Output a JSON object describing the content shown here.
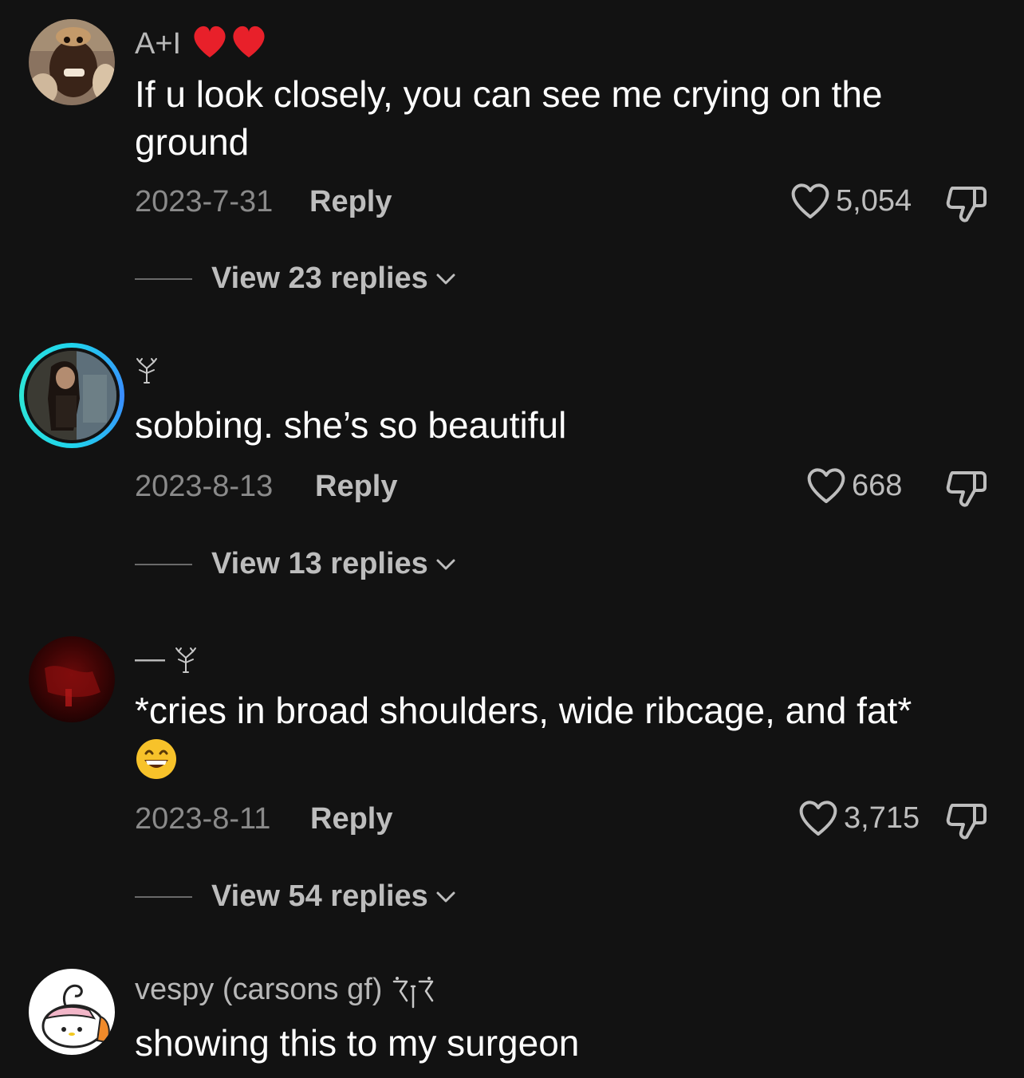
{
  "comments": [
    {
      "username": "A+I",
      "username_emoji": "heart-heart",
      "text": "If u look closely, you can see me crying on the ground",
      "date": "2023-7-31",
      "reply_label": "Reply",
      "likes": "5,054",
      "view_replies": "View 23 replies"
    },
    {
      "username": "",
      "username_glyph": "tree-glyph",
      "text": "sobbing. she’s so beautiful",
      "date": "2023-8-13",
      "reply_label": "Reply",
      "likes": "668",
      "view_replies": "View 13 replies"
    },
    {
      "username": "—",
      "username_glyph": "tree-glyph",
      "text": "*cries in broad shoulders, wide ribcage, and fat*",
      "text_emoji": "grinning-face",
      "date": "2023-8-11",
      "reply_label": "Reply",
      "likes": "3,715",
      "view_replies": "View 54 replies"
    },
    {
      "username": "vespy (carsons gf)",
      "username_glyph": "bow-glyph",
      "text": "showing this to my surgeon"
    }
  ],
  "colors": {
    "background": "#121212",
    "primary_text": "#ffffff",
    "secondary_text": "#8a8a8a",
    "story_ring": "#20d5ec"
  }
}
